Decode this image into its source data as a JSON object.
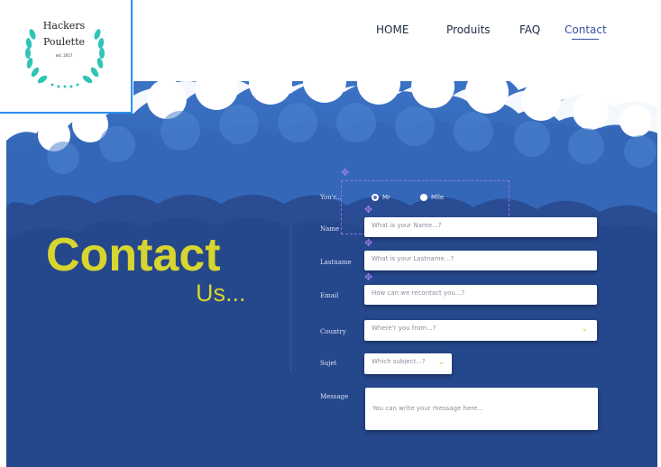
{
  "brand": {
    "line1": "Hackers",
    "line2": "Poulette",
    "line3": "est. 2017"
  },
  "nav": {
    "home": "HOME",
    "produits": "Produits",
    "faq": "FAQ",
    "contact": "Contact"
  },
  "hero": {
    "title": "Contact",
    "subtitle": "Us..."
  },
  "form": {
    "gender_label": "You'r...",
    "radio_mr": "Mr",
    "radio_mlle": "Mlle",
    "name_label": "Name",
    "name_placeholder": "What is your Name...?",
    "lastname_label": "Lastname",
    "lastname_placeholder": "What is your Lastname...?",
    "email_label": "Email",
    "email_placeholder": "How can we recontact you...?",
    "country_label": "Country",
    "country_placeholder": "Where'r you from...?",
    "subject_label": "Sujet",
    "subject_placeholder": "Which subject...?",
    "message_label": "Message",
    "message_placeholder": "You can write your message here..."
  },
  "colors": {
    "accent": "#d7d52f",
    "nav_active": "#3a4fa3",
    "sky_dark": "#233f84"
  },
  "icons": {
    "laurel": "laurel-wreath-icon",
    "dropdown": "chevron-down-icon",
    "selection": "move-handle-icon"
  }
}
